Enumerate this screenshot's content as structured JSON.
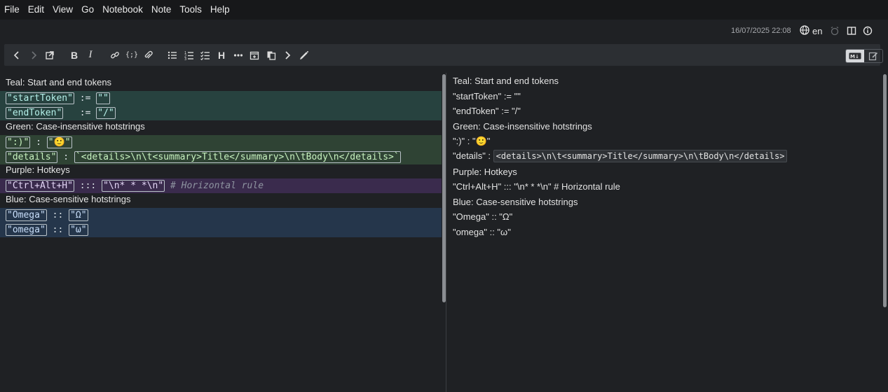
{
  "menu": [
    "File",
    "Edit",
    "View",
    "Go",
    "Notebook",
    "Note",
    "Tools",
    "Help"
  ],
  "header": {
    "date": "16/07/2025 22:08",
    "language": "en"
  },
  "toolbar": {
    "heading_label": "H",
    "bold_label": "B",
    "italic_label": "I",
    "code_label": "{;}"
  },
  "editor": {
    "teal_label": "Teal: Start and end tokens",
    "teal_lines": [
      {
        "key": "\"startToken\"",
        "op": " := ",
        "value": "\"\""
      },
      {
        "key": "\"endToken\"",
        "op": "   := ",
        "value": "\"/\""
      }
    ],
    "green_label": "Green: Case-insensitive hotstrings",
    "green_lines": [
      {
        "key": "\":)\"",
        "op": " : ",
        "value": "\"🙂\""
      },
      {
        "key": "\"details\"",
        "op": " : ",
        "value": "`<details>\\n\\t<summary>Title</summary>\\n\\tBody\\n</details>`"
      }
    ],
    "purple_label": "Purple: Hotkeys",
    "purple_line": {
      "key": "\"Ctrl+Alt+H\"",
      "op": " ::: ",
      "value": "\"\\n* * *\\n\"",
      "comment": " # Horizontal rule"
    },
    "blue_label": "Blue: Case-sensitive hotstrings",
    "blue_lines": [
      {
        "key": "\"Omega\"",
        "op": " :: ",
        "value": "\"Ω\""
      },
      {
        "key": "\"omega\"",
        "op": " :: ",
        "value": "\"ω\""
      }
    ]
  },
  "preview": {
    "lines": [
      "Teal: Start and end tokens",
      "\"startToken\" := \"\"",
      "\"endToken\" := \"/\"",
      "Green: Case-insensitive hotstrings",
      "\":)\" : \"🙂\"",
      "\"details\" : ",
      "Purple: Hotkeys",
      "\"Ctrl+Alt+H\" ::: \"\\n* * *\\n\" # Horizontal rule",
      "Blue: Case-sensitive hotstrings",
      "\"Omega\" :: \"Ω\"",
      "\"omega\" :: \"ω\""
    ],
    "details_code": "<details>\\n\\t<summary>Title</summary>\\n\\tBody\\n</details>"
  },
  "colors": {
    "teal": "#27423f",
    "green": "#2f4334",
    "purple": "#3a2b4d",
    "blue": "#25364b"
  }
}
